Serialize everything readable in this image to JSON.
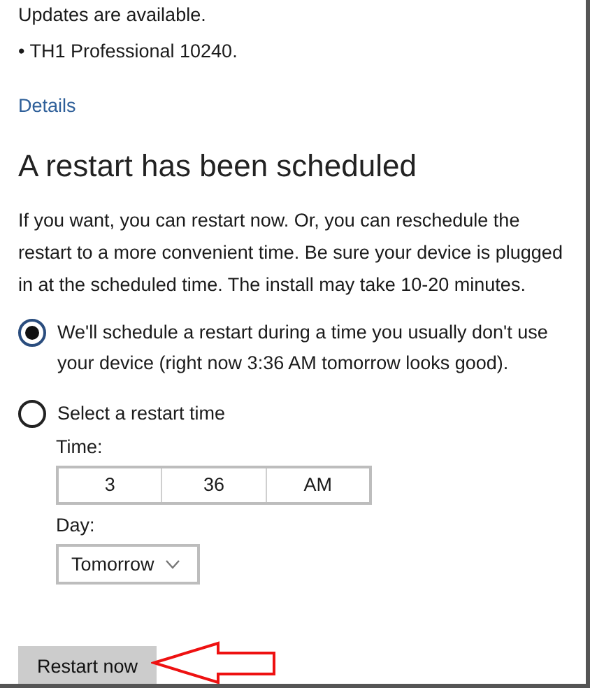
{
  "status": "Updates are available.",
  "updates": [
    "• TH1 Professional 10240."
  ],
  "details_link": "Details",
  "heading": "A restart has been scheduled",
  "description": "If you want, you can restart now. Or, you can reschedule the restart to a more convenient time. Be sure your device is plugged in at the scheduled time. The install may take 10-20 minutes.",
  "options": [
    {
      "label": "We'll schedule a restart during a time you usually don't use your device (right now 3:36 AM tomorrow looks good).",
      "selected": true
    },
    {
      "label": "Select a restart time",
      "selected": false
    }
  ],
  "time": {
    "label": "Time:",
    "hour": "3",
    "minute": "36",
    "period": "AM"
  },
  "day": {
    "label": "Day:",
    "value": "Tomorrow"
  },
  "restart_button": "Restart now"
}
